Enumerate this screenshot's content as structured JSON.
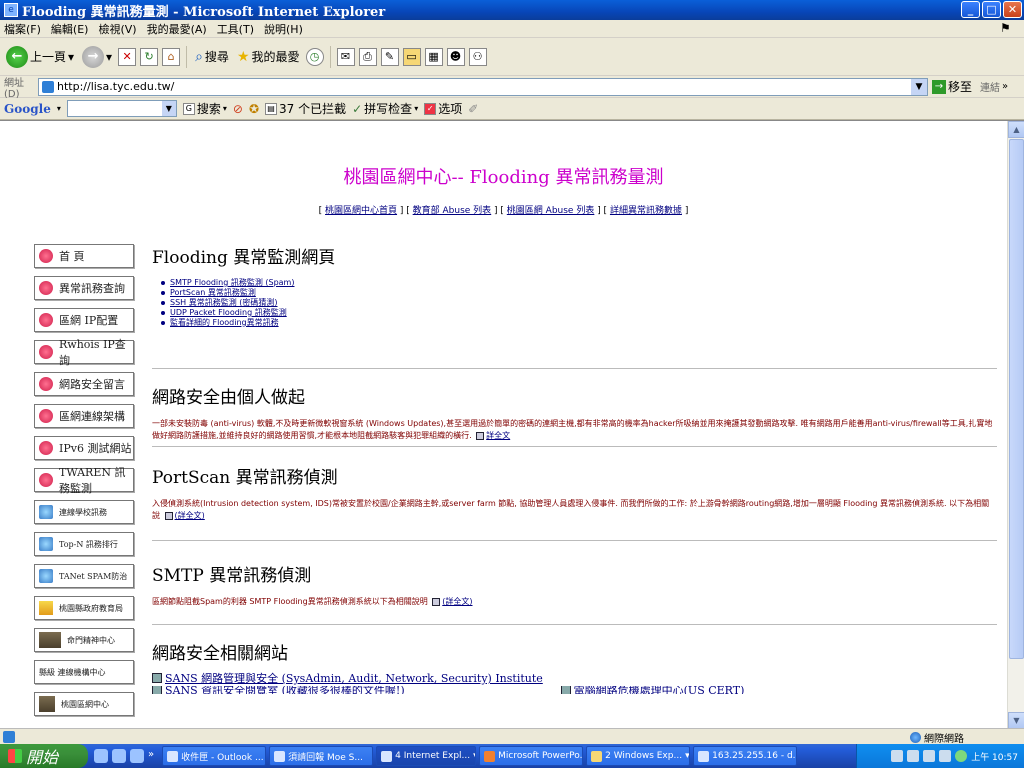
{
  "window": {
    "title": "Flooding 異常訊務量測 - Microsoft Internet Explorer",
    "min": "_",
    "max": "□",
    "close": "✕"
  },
  "menu": [
    "檔案(F)",
    "編輯(E)",
    "檢視(V)",
    "我的最愛(A)",
    "工具(T)",
    "說明(H)"
  ],
  "toolbar": {
    "back": "上一頁",
    "search": "搜尋",
    "favorites": "我的最愛"
  },
  "address": {
    "label": "網址(D)",
    "url": "http://lisa.tyc.edu.tw/",
    "go": "移至",
    "links": "連結"
  },
  "google": {
    "logo": "Google",
    "search": "搜索",
    "blocked": "37 个已拦截",
    "spell": "拼写检查",
    "options": "选项"
  },
  "page": {
    "title": "桃園區網中心-- Flooding 異常訊務量測",
    "toplinks": [
      "[ ",
      "桃園區網中心首頁",
      " ] [ ",
      "教育部 Abuse 列表",
      " ] [ ",
      "桃園區網 Abuse 列表",
      " ] [ ",
      "詳細異常訊務數據",
      " ]"
    ]
  },
  "nav": [
    {
      "label": "首 頁",
      "icon": "heart"
    },
    {
      "label": "異常訊務查詢",
      "icon": "heart"
    },
    {
      "label": "區網 IP配置",
      "icon": "heart"
    },
    {
      "label": "Rwhois IP查詢",
      "icon": "heart"
    },
    {
      "label": "網路安全留言",
      "icon": "heart"
    },
    {
      "label": "區網連線架構",
      "icon": "heart"
    },
    {
      "label": "IPv6 測試網站",
      "icon": "heart"
    },
    {
      "label": "TWAREN 訊務監測",
      "icon": "heart"
    },
    {
      "label": "連線學校訊務",
      "icon": "globe"
    },
    {
      "label": "Top-N 訊務排行",
      "icon": "globe"
    },
    {
      "label": "TANet SPAM防治",
      "icon": "globe"
    },
    {
      "label": "桃園縣政府教育局",
      "icon": "note"
    },
    {
      "label": "命門精神中心",
      "icon": "photo"
    },
    {
      "label": "縣級 連線機構中心",
      "icon": "photo"
    },
    {
      "label": "桃園區網中心",
      "icon": "photo"
    }
  ],
  "sections": {
    "flooding": {
      "title": "Flooding 異常監測網頁",
      "items": [
        "SMTP Flooding 訊務監測 (Spam)",
        "PortScan 異常訊務監測",
        "SSH 異常訊務監測 (密碼猜測)",
        "UDP Packet Flooding 訊務監測",
        "監看詳細的 Flooding異常訊務"
      ]
    },
    "security": {
      "title": "網路安全由個人做起",
      "text": "一部未安裝防毒 (anti-virus) 軟體,不及時更新微軟視窗系統 (Windows Updates),甚至選用過於簡單的密碼的連網主機,都有非常高的機率為hacker所吸納並用來掩護其發動網路攻擊. 唯有網路用戶能善用anti-virus/firewall等工具,扎實地做好網路防護措施,並維持良好的網路使用習慣,才能根本地阻截網路駭客與犯罪組織的橫行.",
      "more": "詳全文"
    },
    "portscan": {
      "title": "PortScan 異常訊務偵測",
      "text": "入侵偵測系統(Intrusion detection system, IDS)常被安置於校園/企業網路主幹,或server farm 節點, 協助管理人員處理入侵事件. 而我們所做的工作: 於上游骨幹網路routing網路,增加一層明顯 Flooding 異常訊務偵測系統. 以下為相關說",
      "more": "(詳全文)"
    },
    "smtp": {
      "title": "SMTP 異常訊務偵測",
      "text": "區網節點阻截Spam的利器 SMTP Flooding異常訊務偵測系統以下為相關說明",
      "more": "(詳全文)"
    },
    "sites": {
      "title": "網路安全相關網站",
      "items": [
        "SANS 網路管理與安全 (SysAdmin, Audit, Network, Security) Institute",
        "SANS 資訊安全閱覽室 (收藏很多很棒的文件喔!)",
        "電腦網路危機處理中心(US CERT)"
      ]
    }
  },
  "status": {
    "zone": "網際網路"
  },
  "taskbar": {
    "start": "開始",
    "tasks": [
      "收件匣 - Outlook ...",
      "須請回報 Moe S...",
      "4 Internet Expl...",
      "Microsoft PowerPo...",
      "2 Windows Exp...",
      "163.25.255.16 - d..."
    ],
    "clock": "上午 10:57"
  }
}
